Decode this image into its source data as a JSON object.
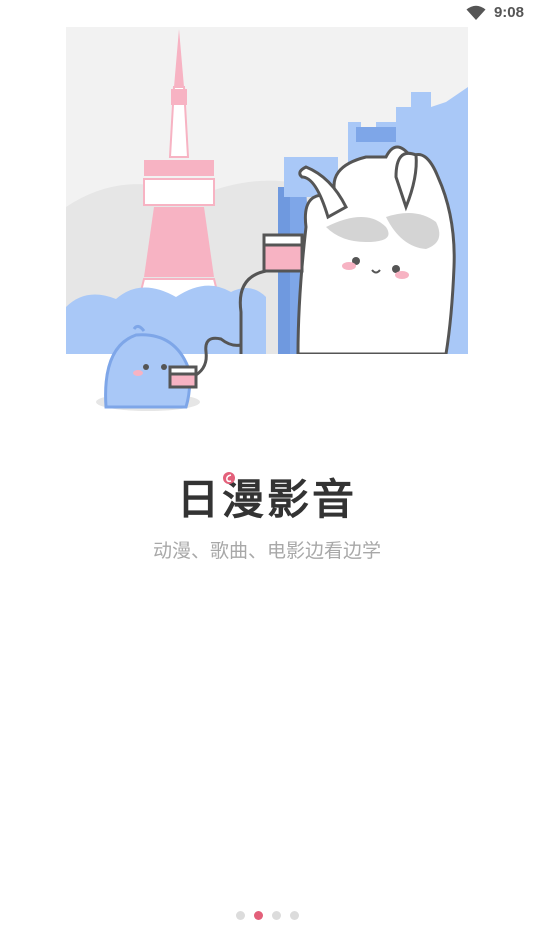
{
  "status_bar": {
    "time": "9:08",
    "wifi_icon": "wifi-icon"
  },
  "onboarding": {
    "illustration": "tokyo-tower-bunny-bird-illustration",
    "title": "日漫影音",
    "subtitle": "动漫、歌曲、电影边看边学",
    "pager": {
      "total": 4,
      "active_index": 1
    }
  },
  "colors": {
    "accent": "#e3607a",
    "title": "#333333",
    "subtitle": "#a8a8a8",
    "dot_inactive": "#dcdcdc",
    "illustration_blue": "#a9c8f7",
    "illustration_pink": "#f7b3c3"
  }
}
